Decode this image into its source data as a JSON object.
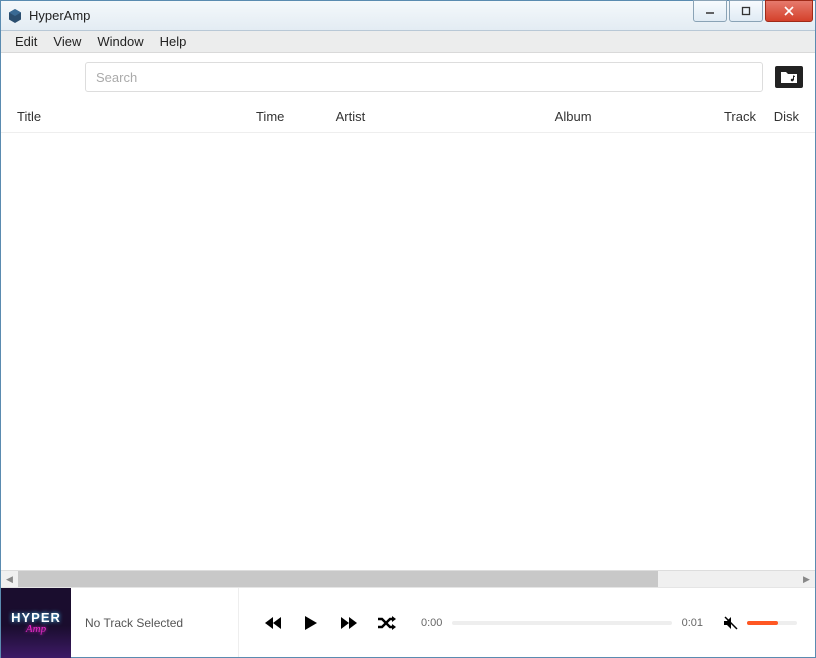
{
  "window": {
    "title": "HyperAmp"
  },
  "menubar": {
    "items": [
      "Edit",
      "View",
      "Window",
      "Help"
    ]
  },
  "search": {
    "placeholder": "Search",
    "value": ""
  },
  "columns": {
    "title": "Title",
    "time": "Time",
    "artist": "Artist",
    "album": "Album",
    "track": "Track",
    "disk": "Disk"
  },
  "player": {
    "now_playing": "No Track Selected",
    "current_time": "0:00",
    "total_time": "0:01",
    "volume_pct": 62
  },
  "colors": {
    "accent": "#ff5722",
    "titlebar_border": "#5a8bb0",
    "close_btn": "#d4412b"
  }
}
